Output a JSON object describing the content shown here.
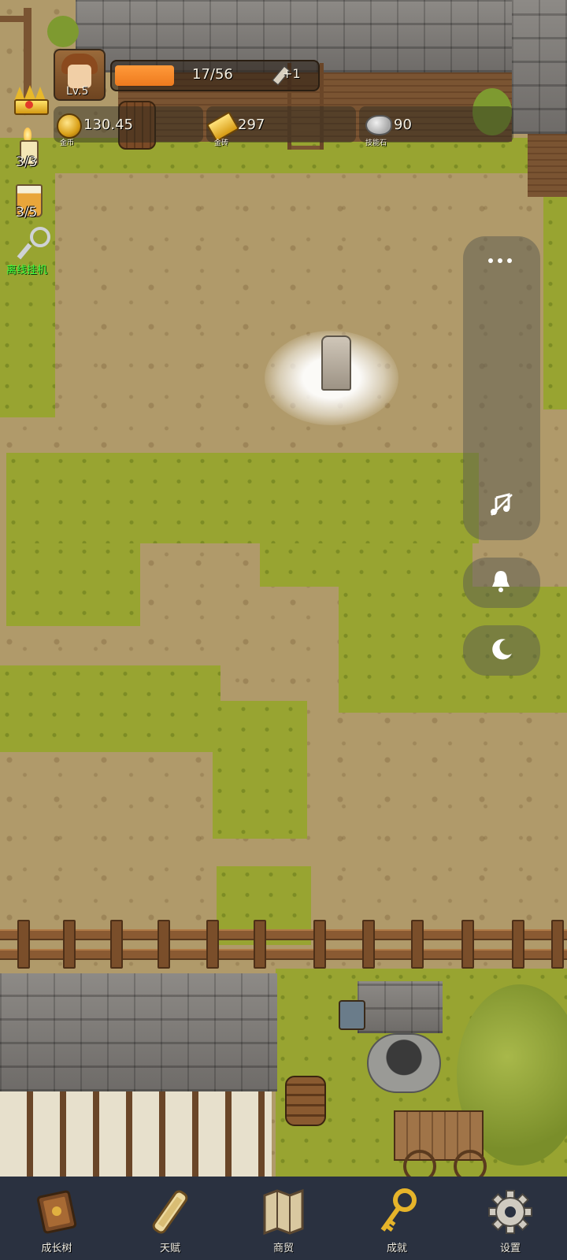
{
  "player": {
    "level": "Lv.5",
    "xp_text": "17/56",
    "xp_fraction": 0.3,
    "xp_bonus": "+1"
  },
  "resources": {
    "gold_coin": {
      "value": "130.45",
      "caption": "金币",
      "icon": "coin-icon"
    },
    "gold_bar": {
      "value": "297",
      "caption": "金砖",
      "icon": "gold-bar-icon"
    },
    "skill_stone": {
      "value": "90",
      "caption": "技能石",
      "icon": "stone-icon"
    }
  },
  "left_items": {
    "candle_count": "3/3",
    "beer_count": "3/5",
    "afk_label": "离线挂机"
  },
  "side_panel": {
    "icons": [
      "more-icon",
      "music-off-icon",
      "bell-icon",
      "moon-icon"
    ]
  },
  "bottom_nav": {
    "items": [
      {
        "label": "成长树",
        "icon": "book-icon"
      },
      {
        "label": "天赋",
        "icon": "scroll-icon"
      },
      {
        "label": "商贸",
        "icon": "map-icon"
      },
      {
        "label": "成就",
        "icon": "key-icon"
      },
      {
        "label": "设置",
        "icon": "gear-icon"
      }
    ]
  },
  "colors": {
    "xp_fill": "#ee7a1e",
    "nav_bg": "#2a3140",
    "afk_text": "#3dff3d",
    "grass": "#98a431",
    "dirt": "#b09a6a"
  }
}
